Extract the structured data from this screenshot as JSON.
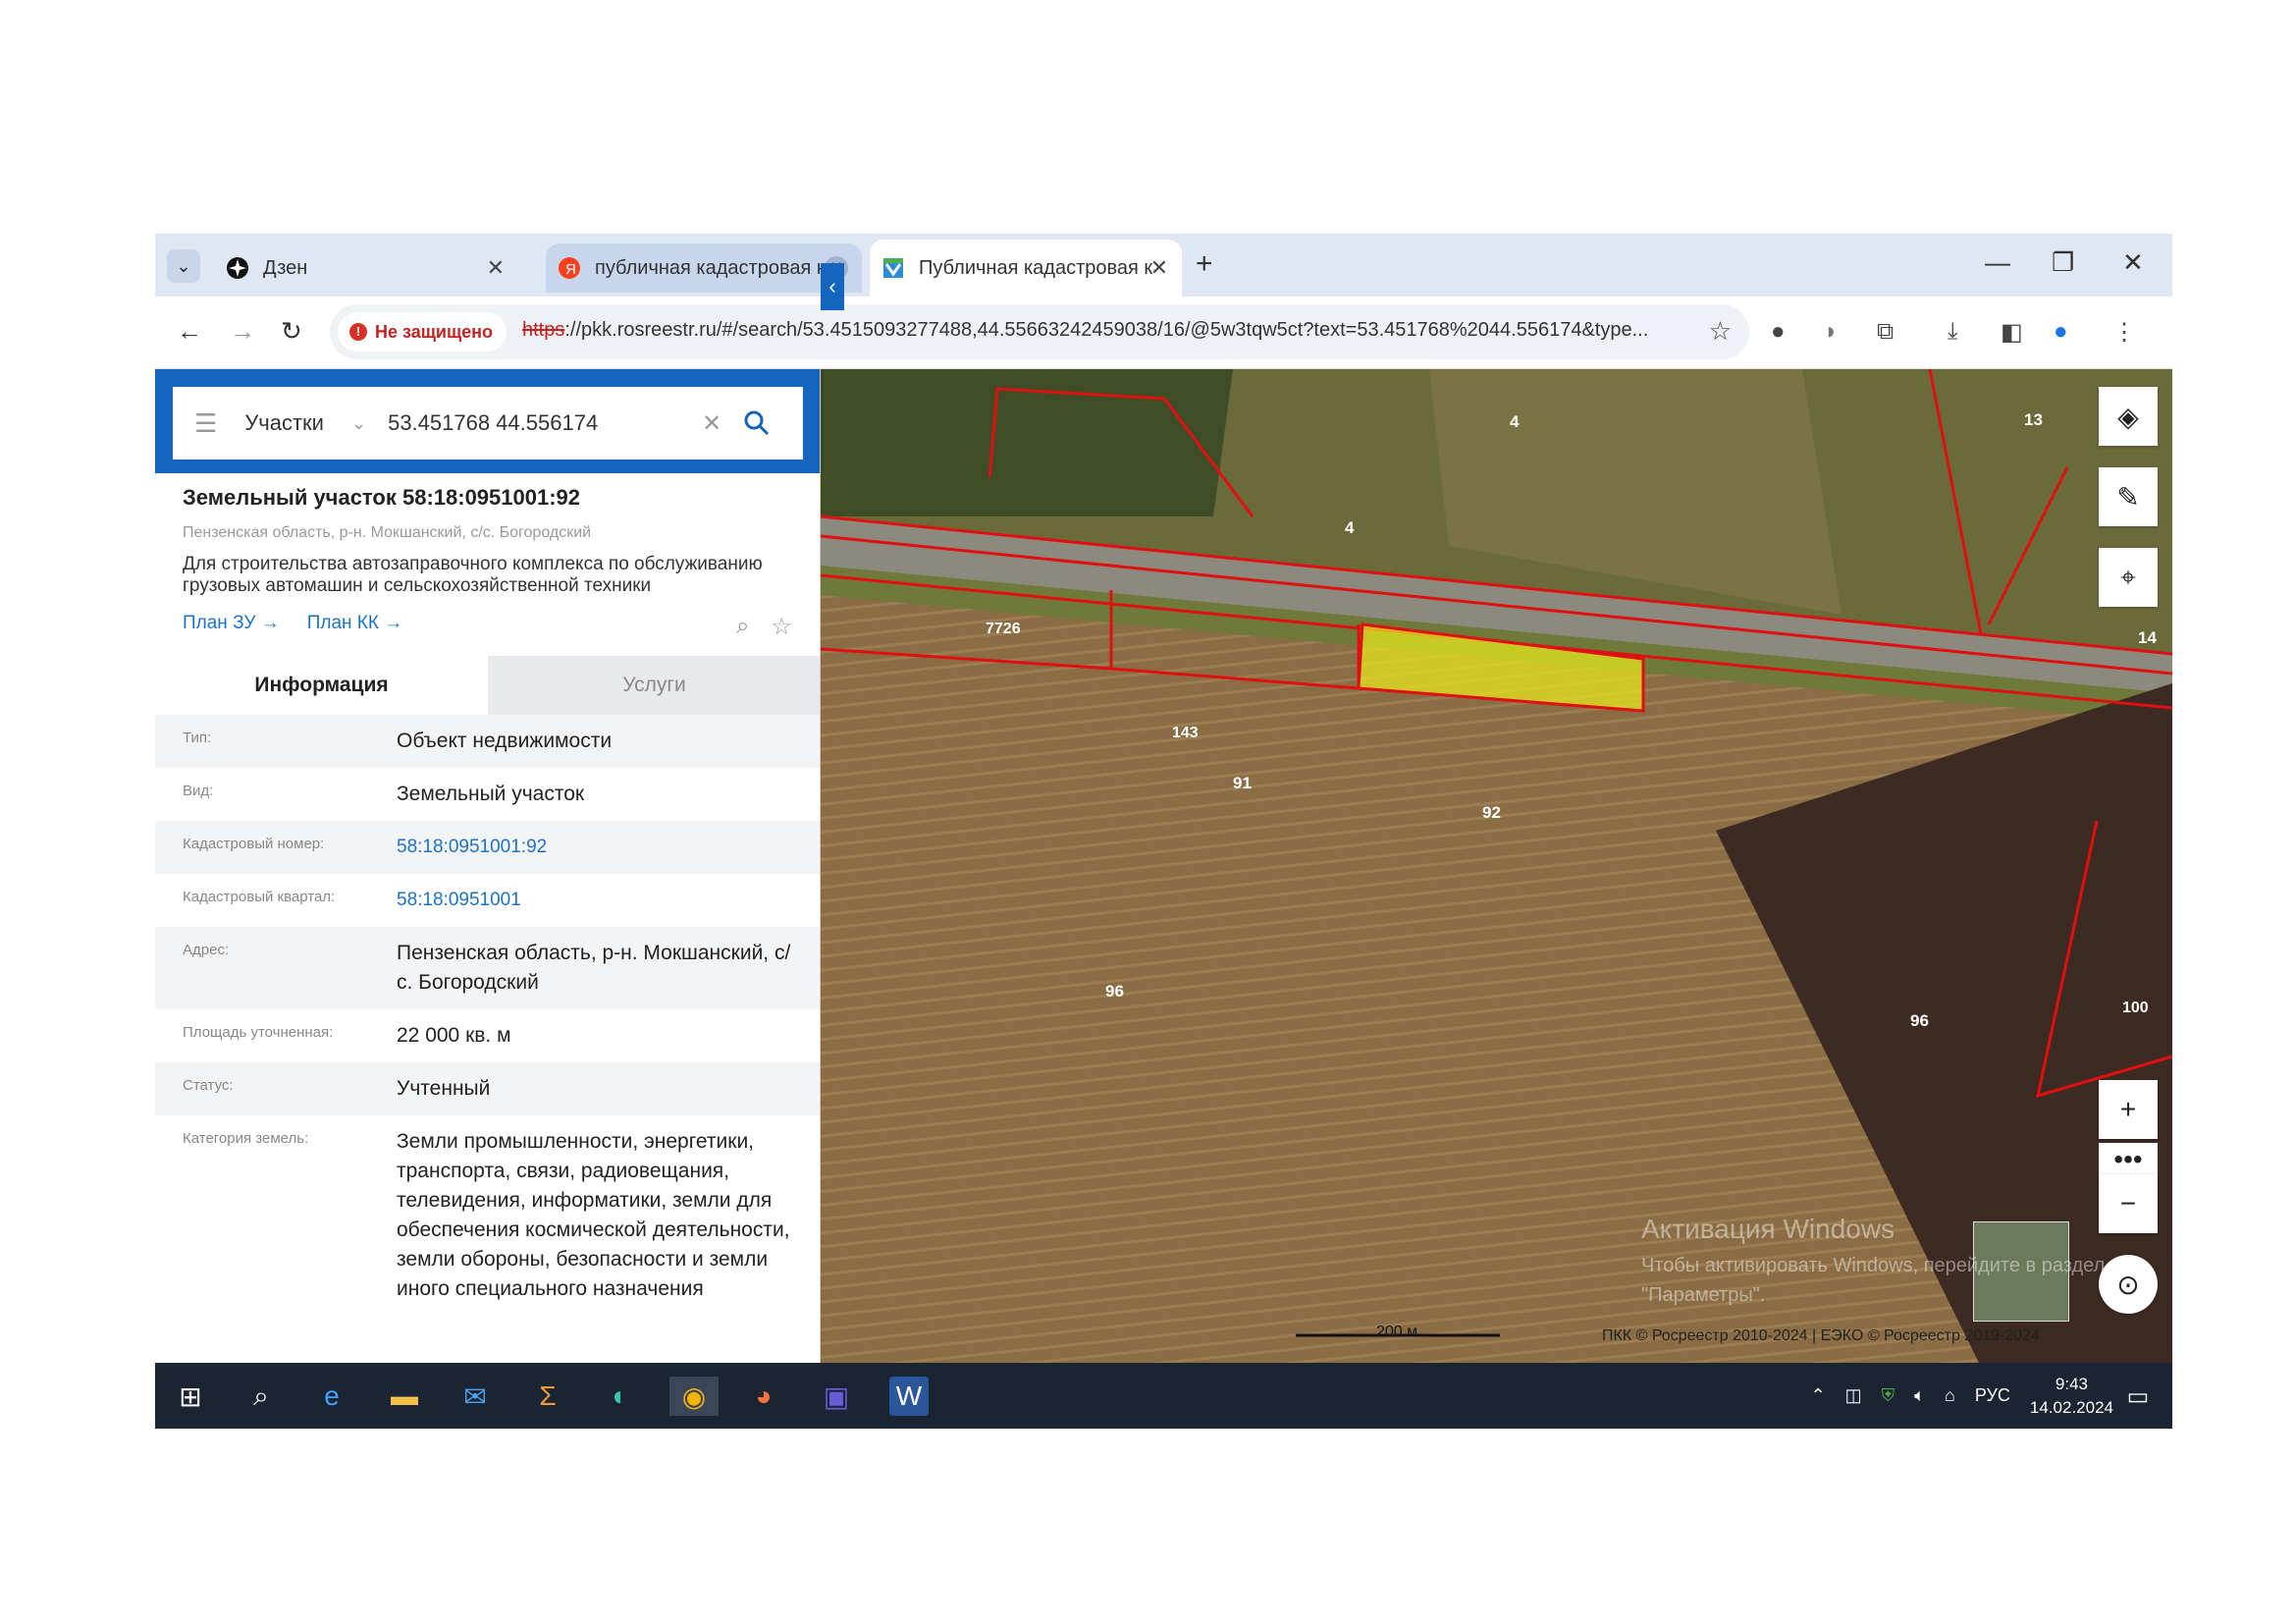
{
  "browser": {
    "tabs": [
      {
        "title": "Дзен"
      },
      {
        "title": "публичная кадастровая кар"
      },
      {
        "title": "Публичная кадастровая ка"
      }
    ],
    "security_label": "Не защищено",
    "url_scheme": "https",
    "url_rest": "://pkk.rosreestr.ru/#/search/53.4515093277488,44.55663242459038/16/@5w3tqw5ct?text=53.451768%2044.556174&type..."
  },
  "search": {
    "layer": "Участки",
    "query": "53.451768 44.556174"
  },
  "object": {
    "title": "Земельный участок 58:18:0951001:92",
    "region": "Пензенская область, р-н. Мокшанский, с/с. Богородский",
    "purpose": "Для строительства автозаправочного комплекса по обслуживанию грузовых автомашин и сельскохозяйственной техники",
    "plan_zu": "План ЗУ →",
    "plan_kk": "План КК →"
  },
  "tabs": {
    "info": "Информация",
    "services": "Услуги"
  },
  "info_rows": [
    {
      "label": "Тип:",
      "value": "Объект недвижимости"
    },
    {
      "label": "Вид:",
      "value": "Земельный участок"
    },
    {
      "label": "Кадастровый номер:",
      "value": "58:18:0951001:92"
    },
    {
      "label": "Кадастровый квартал:",
      "value": "58:18:0951001"
    },
    {
      "label": "Адрес:",
      "value": "Пензенская область, р-н. Мокшанский, с/с. Богородский"
    },
    {
      "label": "Площадь уточненная:",
      "value": "22 000 кв. м"
    },
    {
      "label": "Статус:",
      "value": "Учтенный"
    },
    {
      "label": "Категория земель:",
      "value": "Земли промышленности, энергетики, транспорта, связи, радиовещания, телевидения, информатики, земли для обеспечения космической деятельности, земли обороны, безопасности и земли иного специального назначения"
    }
  ],
  "map": {
    "parcel_labels": [
      "4",
      "13",
      "4",
      "14",
      "7726",
      "143",
      "91",
      "92",
      "96",
      "96",
      "100"
    ],
    "scale": "200 м",
    "copyright": "ПКК © Росреестр 2010-2024 | ЕЭКО © Росреестр 2019-2024",
    "activation_title": "Активация Windows",
    "activation_sub": "Чтобы активировать Windows, перейдите в раздел \"Параметры\"."
  },
  "taskbar": {
    "lang": "РУС",
    "time": "9:43",
    "date": "14.02.2024"
  },
  "colors": {
    "accent": "#1565c0",
    "parcel_fill": "#e6e61e",
    "boundary": "#e01010"
  }
}
